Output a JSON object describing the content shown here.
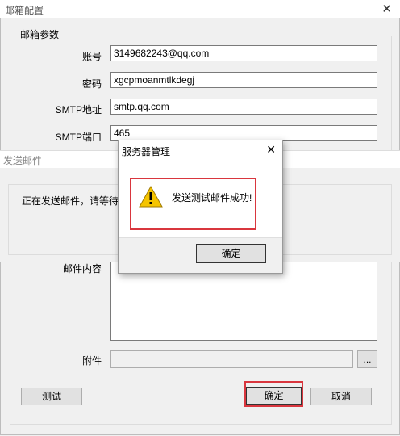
{
  "window": {
    "title": "邮箱配置",
    "close_glyph": "✕"
  },
  "group": {
    "label": "邮箱参数"
  },
  "fields": {
    "account": {
      "label": "账号",
      "value": "3149682243@qq.com"
    },
    "password": {
      "label": "密码",
      "value": "xgcpmoanmtlkdegj"
    },
    "smtp_addr": {
      "label": "SMTP地址",
      "value": "smtp.qq.com"
    },
    "smtp_port": {
      "label": "SMTP端口",
      "value": "465"
    },
    "content": {
      "label": "邮件内容"
    },
    "attachment": {
      "label": "附件",
      "value": "",
      "browse_label": "..."
    }
  },
  "buttons": {
    "test": "测试",
    "ok": "确定",
    "cancel": "取消"
  },
  "send_window": {
    "title": "发送邮件",
    "message": "正在发送邮件，请等待"
  },
  "dialog": {
    "title": "服务器管理",
    "close_glyph": "✕",
    "message": "发送测试邮件成功!",
    "ok_label": "确定",
    "icon": "warning-icon"
  }
}
